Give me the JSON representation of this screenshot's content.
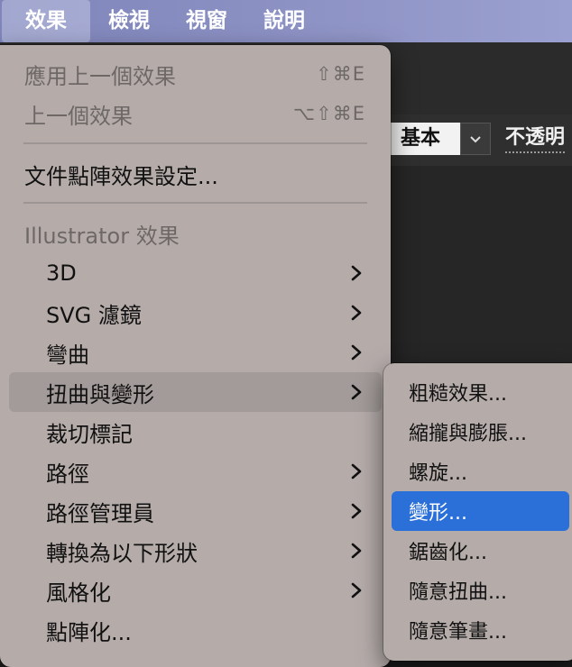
{
  "menubar": {
    "items": [
      {
        "label": "效果",
        "active": true
      },
      {
        "label": "檢視",
        "active": false
      },
      {
        "label": "視窗",
        "active": false
      },
      {
        "label": "說明",
        "active": false
      }
    ]
  },
  "app": {
    "preset_label": "基本",
    "opacity_label": "不透明"
  },
  "effect_menu": {
    "apply_last": {
      "label": "應用上一個效果",
      "shortcut": "⇧⌘E",
      "enabled": false
    },
    "last_effect": {
      "label": "上一個效果",
      "shortcut": "⌥⇧⌘E",
      "enabled": false
    },
    "document_raster": {
      "label": "文件點陣效果設定..."
    },
    "illustrator_header": "Illustrator 效果",
    "items": [
      {
        "label": "3D",
        "submenu": true
      },
      {
        "label": "SVG 濾鏡",
        "submenu": true
      },
      {
        "label": "彎曲",
        "submenu": true
      },
      {
        "label": "扭曲與變形",
        "submenu": true,
        "highlighted": true
      },
      {
        "label": "裁切標記",
        "submenu": false
      },
      {
        "label": "路徑",
        "submenu": true
      },
      {
        "label": "路徑管理員",
        "submenu": true
      },
      {
        "label": "轉換為以下形狀",
        "submenu": true
      },
      {
        "label": "風格化",
        "submenu": true
      },
      {
        "label": "點陣化...",
        "submenu": false
      }
    ]
  },
  "distort_submenu": {
    "items": [
      {
        "label": "粗糙效果...",
        "selected": false
      },
      {
        "label": "縮攏與膨脹...",
        "selected": false
      },
      {
        "label": "螺旋...",
        "selected": false
      },
      {
        "label": "變形...",
        "selected": true
      },
      {
        "label": "鋸齒化...",
        "selected": false
      },
      {
        "label": "隨意扭曲...",
        "selected": false
      },
      {
        "label": "隨意筆畫...",
        "selected": false
      }
    ]
  },
  "colors": {
    "menu_bg": "#b5acaa",
    "highlight": "#a39b99",
    "selection": "#2b6fd8",
    "menubar": "#8b90c3"
  }
}
